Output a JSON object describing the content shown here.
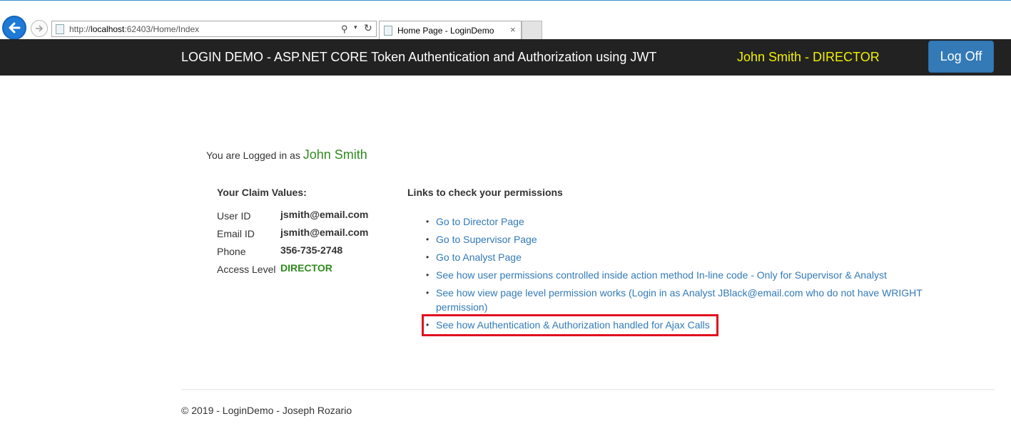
{
  "browser": {
    "url_prefix": "http://",
    "url_host": "localhost",
    "url_rest": ":62403/Home/Index",
    "tab_title": "Home Page - LoginDemo",
    "tab_close": "×"
  },
  "navbar": {
    "brand": "LOGIN DEMO - ASP.NET CORE Token Authentication and Authorization using JWT",
    "user_role": "John Smith - DIRECTOR",
    "logoff_label": "Log Off"
  },
  "main": {
    "logged_prefix": "You are Logged in as",
    "logged_name": "John Smith",
    "claims_title": "Your Claim Values:",
    "claims": [
      {
        "key": "User ID",
        "value": "jsmith@email.com"
      },
      {
        "key": "Email ID",
        "value": "jsmith@email.com"
      },
      {
        "key": "Phone",
        "value": "356-735-2748"
      },
      {
        "key": "Access Level",
        "value": "DIRECTOR"
      }
    ],
    "links_title": "Links to check your permissions",
    "links": [
      "Go to Director Page",
      "Go to Supervisor Page",
      "Go to Analyst Page",
      "See how user permissions controlled inside action method In-line code - Only for Supervisor & Analyst",
      "See how view page level permission works (Login in as Analyst JBlack@email.com who do not have WRIGHT permission)",
      "See how Authentication & Authorization handled for Ajax Calls"
    ]
  },
  "footer": {
    "text": "© 2019 - LoginDemo - Joseph Rozario"
  },
  "colors": {
    "navbar_bg": "#222222",
    "user_role": "#f0f000",
    "logoff_bg": "#337ab7",
    "link": "#337ab7",
    "green": "#2e8b1e",
    "highlight": "#e0101e"
  }
}
